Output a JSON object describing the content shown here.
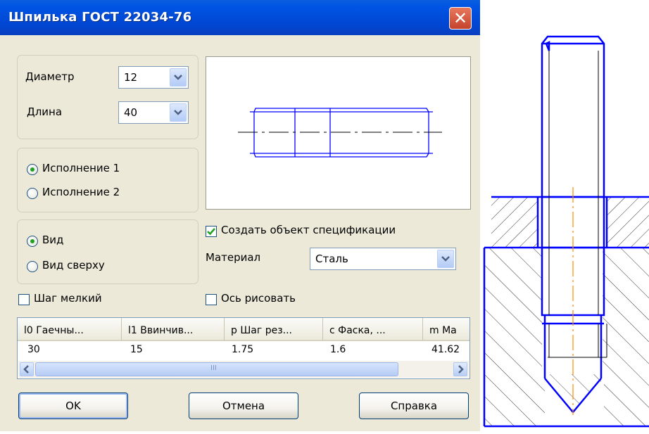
{
  "dialog": {
    "title": "Шпилька ГОСТ 22034-76",
    "diameter": {
      "label": "Диаметр",
      "value": "12"
    },
    "length": {
      "label": "Длина",
      "value": "40"
    },
    "execution": [
      {
        "label": "Исполнение 1",
        "selected": true
      },
      {
        "label": "Исполнение 2",
        "selected": false
      }
    ],
    "view": [
      {
        "label": "Вид",
        "selected": true
      },
      {
        "label": "Вид сверху",
        "selected": false
      }
    ],
    "create_spec": {
      "label": "Создать объект спецификации",
      "checked": true
    },
    "material": {
      "label": "Материал",
      "value": "Сталь"
    },
    "fine_pitch": {
      "label": "Шаг мелкий",
      "checked": false
    },
    "draw_axis": {
      "label": "Ось рисовать",
      "checked": false
    },
    "table": {
      "columns": [
        "l0 Гаечны...",
        "l1 Ввинчив...",
        "p Шаг рез...",
        "c Фаска, ...",
        "m Ма"
      ],
      "row": [
        "30",
        "15",
        "1.75",
        "1.6",
        "41.62"
      ],
      "scroll_grip": "III"
    },
    "buttons": {
      "ok": "OK",
      "cancel": "Отмена",
      "help": "Справка"
    }
  },
  "colors": {
    "title_bar": "#0054e3",
    "dialog_bg": "#ece9d8",
    "drawing_lines": "#0000ff",
    "axis_line": "#ff8c00"
  },
  "icons": [
    "close-icon",
    "chevron-down-icon",
    "checkmark-icon",
    "scroll-left-icon",
    "scroll-right-icon"
  ]
}
